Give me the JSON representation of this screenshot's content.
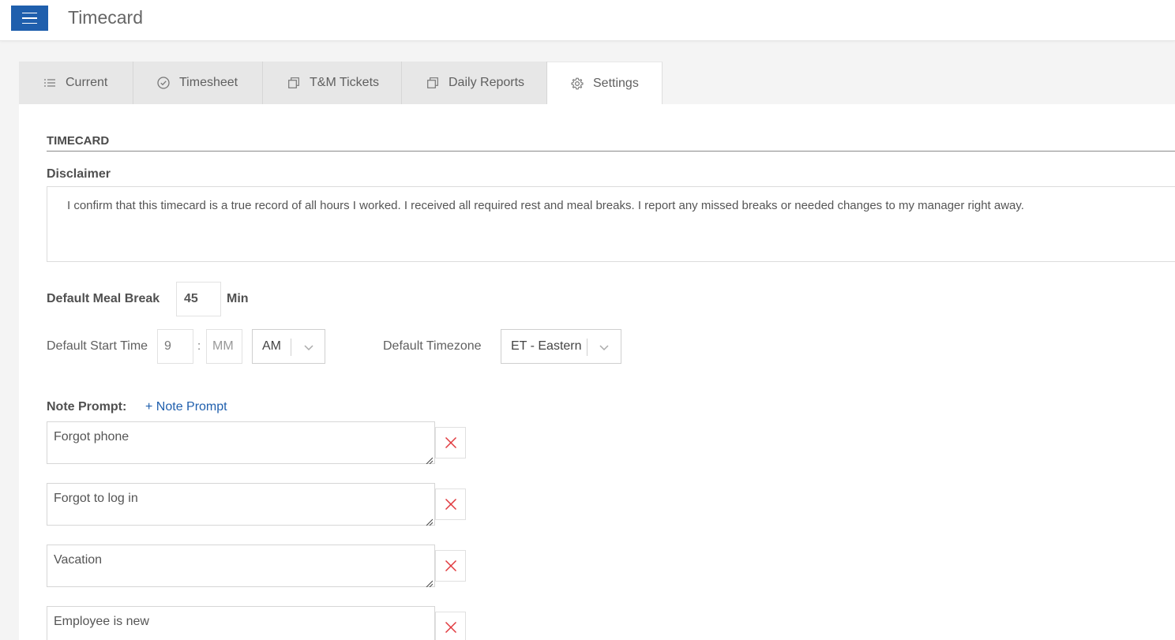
{
  "header": {
    "title": "Timecard"
  },
  "tabs": [
    {
      "label": "Current",
      "icon": "list-icon"
    },
    {
      "label": "Timesheet",
      "icon": "check-circle-icon"
    },
    {
      "label": "T&M Tickets",
      "icon": "copy-icon"
    },
    {
      "label": "Daily Reports",
      "icon": "copy-icon"
    },
    {
      "label": "Settings",
      "icon": "gear-icon",
      "active": true
    }
  ],
  "settings": {
    "section_title": "TIMECARD",
    "disclaimer_label": "Disclaimer",
    "disclaimer_text": "I confirm that this timecard is a true record of all hours I worked. I received all required rest and meal breaks. I report any missed breaks or needed changes to my manager right away.",
    "meal_break_label": "Default Meal Break",
    "meal_break_value": "45",
    "meal_break_unit": "Min",
    "start_time_label": "Default Start Time",
    "start_hour": "9",
    "start_colon": ":",
    "start_minute_placeholder": "MM",
    "start_ampm": "AM",
    "timezone_label": "Default Timezone",
    "timezone_value": "ET - Eastern",
    "note_prompt_label": "Note Prompt:",
    "add_note_prompt": "+ Note Prompt",
    "note_prompts": [
      "Forgot phone",
      "Forgot to log in",
      "Vacation",
      "Employee is new"
    ]
  },
  "colors": {
    "accent": "#1f5fad",
    "delete": "#e0393e"
  }
}
